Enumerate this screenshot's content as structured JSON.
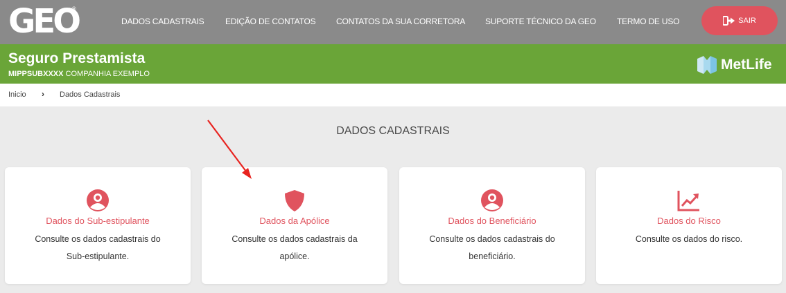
{
  "header": {
    "logo_text": "GEO",
    "logo_reg": "®",
    "nav": [
      {
        "label": "DADOS CADASTRAIS"
      },
      {
        "label": "EDIÇÃO DE CONTATOS"
      },
      {
        "label": "CONTATOS DA SUA CORRETORA"
      },
      {
        "label": "SUPORTE TÉCNICO DA GEO"
      },
      {
        "label": "TERMO DE USO"
      }
    ],
    "exit_label": "SAIR",
    "exit_icon": "sign-out-icon",
    "colors": {
      "bar": "#8a8a8a",
      "exit": "#e0535e"
    }
  },
  "product": {
    "title": "Seguro Prestamista",
    "code": "MIPPSUBXXXX",
    "company": "COMPANHIA EXEMPLO",
    "brand": "MetLife",
    "colors": {
      "bar": "#6aa538"
    }
  },
  "breadcrumb": {
    "home": "Inicio",
    "separator": "›",
    "current": "Dados Cadastrais"
  },
  "main": {
    "title": "DADOS CADASTRAIS",
    "cards": [
      {
        "icon": "user-circle-icon",
        "title": "Dados do Sub-estipulante",
        "desc": "Consulte os dados cadastrais do Sub-estipulante."
      },
      {
        "icon": "shield-icon",
        "title": "Dados da Apólice",
        "desc": "Consulte os dados cadastrais da apólice."
      },
      {
        "icon": "user-circle-icon",
        "title": "Dados do Beneficiário",
        "desc": "Consulte os dados cadastrais do beneficiário."
      },
      {
        "icon": "trend-chart-icon",
        "title": "Dados do Risco",
        "desc": "Consulte os dados do risco."
      }
    ],
    "colors": {
      "accent": "#e0535e",
      "annotation_arrow": "#e8231f"
    }
  }
}
